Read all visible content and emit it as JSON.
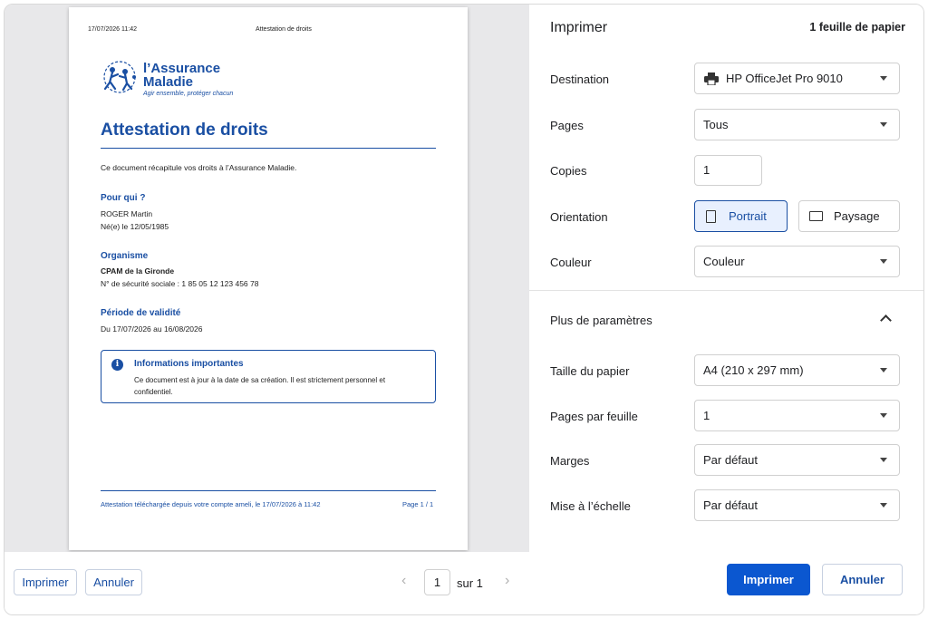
{
  "preview": {
    "header_date": "17/07/2026 11:42",
    "header_title": "Attestation de droits",
    "logo": {
      "name_line1": "l’Assurance",
      "name_line2": "Maladie",
      "tagline": "Agir ensemble, protéger chacun"
    },
    "title": "Attestation de droits",
    "intro": "Ce document récapitule vos droits à l’Assurance Maladie.",
    "section_who": {
      "title": "Pour qui ?",
      "name": "ROGER Martin",
      "birth": "Né(e) le 12/05/1985"
    },
    "section_org": {
      "title": "Organisme",
      "name": "CPAM de la Gironde",
      "ssn": "N° de sécurité sociale : 1 85 05 12 123 456 78"
    },
    "section_validity": {
      "title": "Période de validité",
      "period": "Du 17/07/2026 au 16/08/2026"
    },
    "info": {
      "icon": "info-icon",
      "title": "Informations importantes",
      "text": "Ce document est à jour à la date de sa création. Il est strictement personnel et confidentiel."
    },
    "footer_left": "Attestation téléchargée depuis votre compte ameli, le 17/07/2026 à 11:42",
    "footer_right": "Page 1 / 1"
  },
  "bottom_left": {
    "print_label": "Imprimer",
    "cancel_label": "Annuler",
    "page_current": "1",
    "page_of": "sur 1"
  },
  "panel": {
    "title": "Imprimer",
    "sheets": "1 feuille de papier",
    "destination": {
      "label": "Destination",
      "value": "HP OfficeJet Pro 9010",
      "icon": "printer-icon"
    },
    "pages": {
      "label": "Pages",
      "value": "Tous"
    },
    "copies": {
      "label": "Copies",
      "value": "1"
    },
    "orientation": {
      "label": "Orientation",
      "portrait": "Portrait",
      "landscape": "Paysage",
      "selected": "Portrait"
    },
    "color": {
      "label": "Couleur",
      "value": "Couleur"
    },
    "more": {
      "label": "Plus de paramètres",
      "icon": "chevron-up-icon"
    },
    "paper_size": {
      "label": "Taille du papier",
      "value": "A4 (210 x 297 mm)"
    },
    "pages_per_sheet": {
      "label": "Pages par feuille",
      "value": "1"
    },
    "margins": {
      "label": "Marges",
      "value": "Par défaut"
    },
    "scale": {
      "label": "Mise à l’échelle",
      "value": "Par défaut"
    },
    "print_button": "Imprimer",
    "cancel_button": "Annuler"
  },
  "colors": {
    "brand_blue": "#1a4fa3",
    "primary_button": "#0b57d0",
    "selected_bg": "#e8f0fe"
  }
}
